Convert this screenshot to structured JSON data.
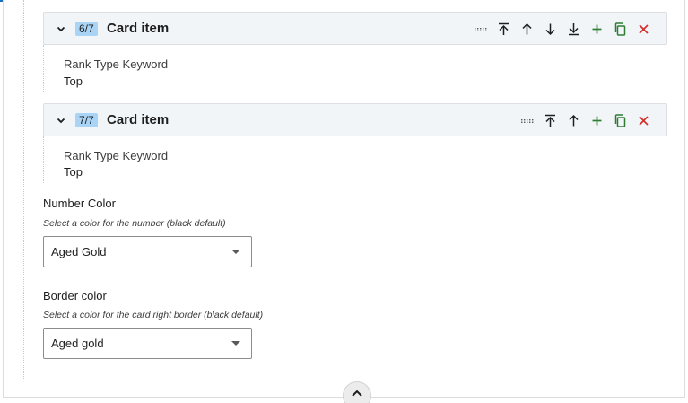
{
  "colors": {
    "accent_blue": "#1b6ec2",
    "add_green": "#2e7d32",
    "remove_red": "#d32f2f",
    "badge_bg": "#a9d4f5"
  },
  "cards": [
    {
      "badge": "6/7",
      "title": "Card item",
      "field_label": "Rank Type Keyword",
      "field_value": "Top",
      "actions": [
        "drag-handle-icon",
        "move-top-icon",
        "move-up-icon",
        "move-down-icon",
        "move-bottom-icon",
        "add-icon",
        "duplicate-icon",
        "remove-icon"
      ]
    },
    {
      "badge": "7/7",
      "title": "Card item",
      "field_label": "Rank Type Keyword",
      "field_value": "Top",
      "actions": [
        "drag-handle-icon",
        "move-top-icon",
        "move-up-icon",
        "add-icon",
        "duplicate-icon",
        "remove-icon"
      ]
    }
  ],
  "number_color": {
    "label": "Number Color",
    "description": "Select a color for the number (black default)",
    "selected": "Aged Gold"
  },
  "border_color": {
    "label": "Border color",
    "description": "Select a color for the card right border (black default)",
    "selected": "Aged gold"
  }
}
